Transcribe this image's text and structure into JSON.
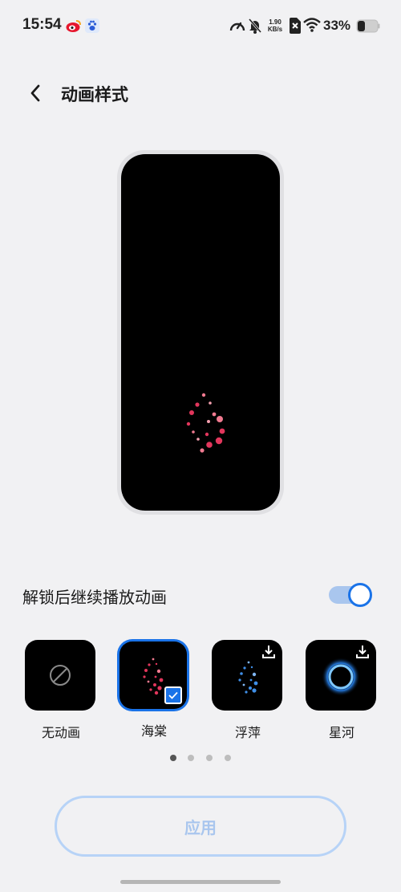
{
  "status_bar": {
    "time": "15:54",
    "net_speed_value": "1.90",
    "net_speed_unit": "KB/s",
    "battery": "33%",
    "icons": [
      "weibo-icon",
      "baidu-icon",
      "speedometer-icon",
      "bell-muted-icon",
      "sim-off-icon",
      "wifi-icon",
      "battery-icon"
    ]
  },
  "header": {
    "title": "动画样式",
    "back_icon": "chevron-left-icon"
  },
  "preview": {
    "animation": "海棠",
    "accent": "#e8476a"
  },
  "toggle": {
    "label": "解锁后继续播放动画",
    "on": true,
    "accent": "#1a73e8"
  },
  "styles": [
    {
      "label": "无动画",
      "icon": "no-animation-icon",
      "selected": false,
      "downloadable": false
    },
    {
      "label": "海棠",
      "icon": "crabapple-particles",
      "selected": true,
      "downloadable": false
    },
    {
      "label": "浮萍",
      "icon": "duckweed-particles",
      "selected": false,
      "downloadable": true
    },
    {
      "label": "星河",
      "icon": "galaxy-ring",
      "selected": false,
      "downloadable": true
    }
  ],
  "pagination": {
    "count": 4,
    "active": 1
  },
  "apply_button": {
    "label": "应用",
    "enabled": false
  }
}
